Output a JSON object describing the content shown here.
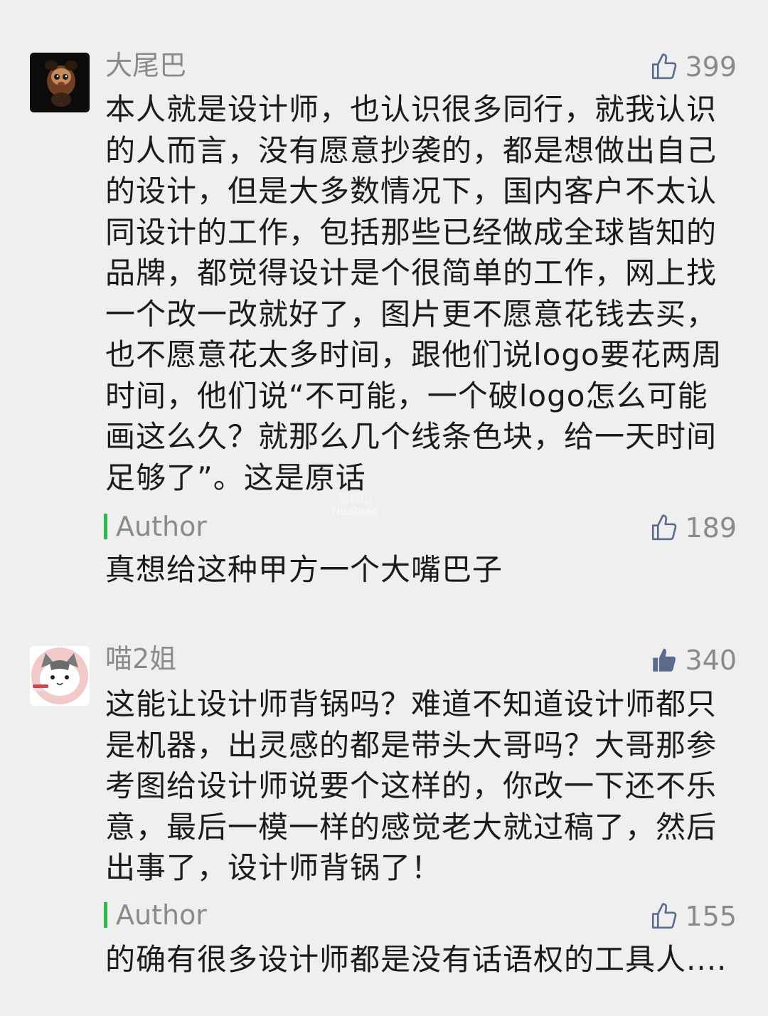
{
  "comments": [
    {
      "nickname": "大尾巴",
      "likes": "399",
      "like_icon": "thumb-up-outline-icon",
      "content_lines": [
        "本人就是设计师，也认识很多同行，就我认识",
        "的人而言，没有愿意抄袭的，都是想做出自己",
        "的设计，但是大多数情况下，国内客户不太认",
        "同设计的工作，包括那些已经做成全球皆知的",
        "品牌，都觉得设计是个很简单的工作，网上找",
        "一个改一改就好了，图片更不愿意花钱去买，",
        "也不愿意花太多时间，跟他们说logo要花两周",
        "时间，他们说“不可能，一个破logo怎么可能",
        "画这么久？就那么几个线条色块，给一天时间",
        "足够了”。这是原话"
      ],
      "reply": {
        "tag": "Author",
        "likes": "189",
        "like_icon": "thumb-up-outline-icon",
        "text": "真想给这种甲方一个大嘴巴子"
      }
    },
    {
      "nickname": "喵2姐",
      "likes": "340",
      "like_icon": "thumb-up-filled-icon",
      "content_lines": [
        "这能让设计师背锅吗？难道不知道设计师都只",
        "是机器，出灵感的都是带头大哥吗？大哥那参",
        "考图给设计师说要个这样的，你改一下还不乐",
        "意，最后一模一样的感觉老大就过稿了，然后",
        "出事了，设计师背锅了！"
      ],
      "reply": {
        "tag": "Author",
        "likes": "155",
        "like_icon": "thumb-up-outline-icon",
        "text": "的确有很多设计师都是没有话语权的工具人...."
      }
    }
  ],
  "watermark": {
    "line1": "追标山",
    "line2": "Huabiao"
  },
  "colors": {
    "background": "#efefef",
    "meta_text": "#8a8a8a",
    "body_text": "#1b1b1b",
    "author_bar": "#2fb84e",
    "like_icon": "#5b6b8c"
  }
}
